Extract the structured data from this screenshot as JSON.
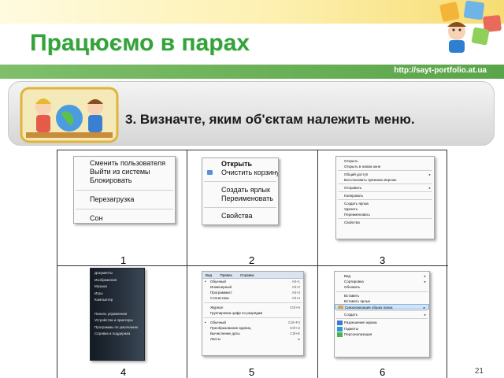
{
  "slide": {
    "title": "Працюємо в парах",
    "url": "http://sayt-portfolio.at.ua",
    "task": "3. Визначте, яким об'єктам належить меню.",
    "page_number": "21"
  },
  "cells": [
    "1",
    "2",
    "3",
    "4",
    "5",
    "6"
  ],
  "menu1": {
    "items": [
      "Сменить пользователя",
      "Выйти из системы",
      "Блокировать",
      "Перезагрузка",
      "Сон"
    ]
  },
  "menu2": {
    "items": [
      "Открыть",
      "Очистить корзину",
      "Создать ярлык",
      "Переименовать",
      "Свойства"
    ]
  },
  "menu3": {
    "items": [
      "Открыть",
      "Открыть в новом окне",
      "Общий доступ",
      "Восстановить прежнюю версию",
      "Отправить",
      "Копировать",
      "Создать ярлык",
      "Удалить",
      "Переименовать",
      "Свойства"
    ]
  },
  "menu4": {
    "items": [
      "Документы",
      "Изображения",
      "Музыка",
      "Игры",
      "Компьютер",
      "Панель управления",
      "Устройства и принтеры",
      "Программы по умолчанию",
      "Справка и поддержка"
    ]
  },
  "menu5": {
    "menubar": [
      "Вид",
      "Правка",
      "Справка"
    ],
    "items": [
      {
        "label": "Обычный",
        "shortcut": "Alt+1"
      },
      {
        "label": "Инженерный",
        "shortcut": "Alt+2"
      },
      {
        "label": "Программист",
        "shortcut": "Alt+3"
      },
      {
        "label": "Статистика",
        "shortcut": "Alt+4"
      },
      {
        "label": "Журнал",
        "shortcut": "Ctrl+H"
      },
      {
        "label": "Группировка цифр по разрядам",
        "shortcut": ""
      },
      {
        "label": "Обычный",
        "shortcut": "Ctrl+F4"
      },
      {
        "label": "Преобразование единиц",
        "shortcut": "Ctrl+U"
      },
      {
        "label": "Вычисление даты",
        "shortcut": "Ctrl+E"
      },
      {
        "label": "Листы",
        "shortcut": ""
      }
    ]
  },
  "menu6": {
    "items": [
      "Вид",
      "Сортировка",
      "Обновить",
      "Вставить",
      "Вставить ярлык",
      "Синхронизация общих папок",
      "Создать",
      "Разрешение экрана",
      "Гаджеты",
      "Персонализация"
    ]
  },
  "colors": {
    "title": "#35a23c",
    "url_bar": "#5aa449",
    "highlight": "#cfe4f8"
  }
}
